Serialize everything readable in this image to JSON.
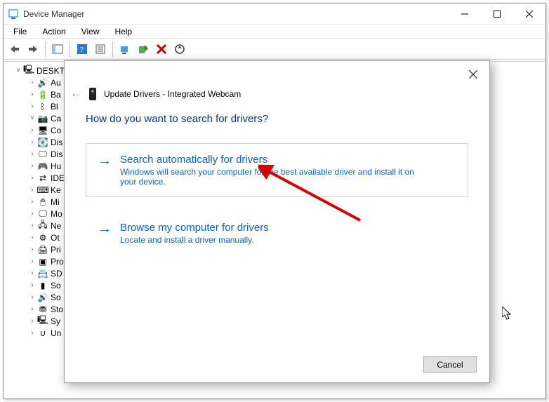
{
  "window": {
    "title": "Device Manager",
    "menu": {
      "file": "File",
      "action": "Action",
      "view": "View",
      "help": "Help"
    },
    "tree": {
      "root": "DESKT",
      "items": [
        {
          "label": "Au",
          "icon": "🔊"
        },
        {
          "label": "Ba",
          "icon": "🔋"
        },
        {
          "label": "Bl",
          "icon": "ᛒ"
        },
        {
          "label": "Ca",
          "icon": "📷",
          "expanded": true
        },
        {
          "label": "Co",
          "icon": "🖥"
        },
        {
          "label": "Dis",
          "icon": "💽"
        },
        {
          "label": "Dis",
          "icon": "🖵"
        },
        {
          "label": "Hu",
          "icon": "🎮"
        },
        {
          "label": "IDE",
          "icon": "⇄"
        },
        {
          "label": "Ke",
          "icon": "⌨"
        },
        {
          "label": "Mi",
          "icon": "🖱"
        },
        {
          "label": "Mo",
          "icon": "🖵"
        },
        {
          "label": "Ne",
          "icon": "🖧"
        },
        {
          "label": "Ot",
          "icon": "⚙"
        },
        {
          "label": "Pri",
          "icon": "🖨"
        },
        {
          "label": "Pro",
          "icon": "▣"
        },
        {
          "label": "SD",
          "icon": "📇"
        },
        {
          "label": "So",
          "icon": "▮"
        },
        {
          "label": "So",
          "icon": "🔊"
        },
        {
          "label": "Sto",
          "icon": "⛃"
        },
        {
          "label": "Sy",
          "icon": "🖳"
        },
        {
          "label": "Un",
          "icon": "∪"
        }
      ]
    }
  },
  "dialog": {
    "title": "Update Drivers - Integrated Webcam",
    "heading": "How do you want to search for drivers?",
    "option1": {
      "title": "Search automatically for drivers",
      "desc": "Windows will search your computer for the best available driver and install it on your device."
    },
    "option2": {
      "title": "Browse my computer for drivers",
      "desc": "Locate and install a driver manually."
    },
    "buttons": {
      "cancel": "Cancel"
    }
  }
}
